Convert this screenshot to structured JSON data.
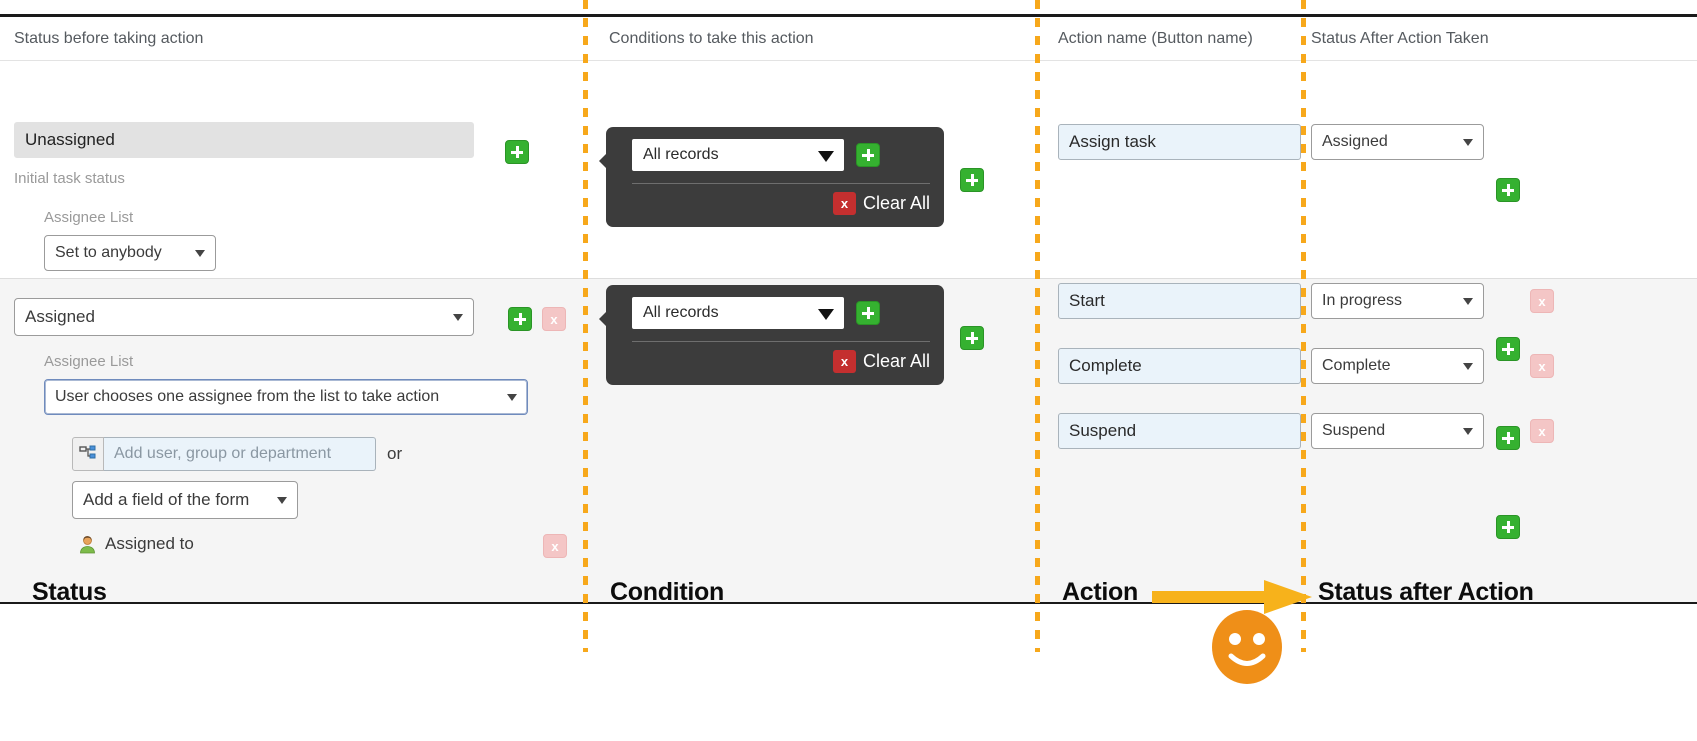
{
  "columns": [
    {
      "key": "status_before",
      "label": "Status before taking action"
    },
    {
      "key": "conditions",
      "label": "Conditions to take this action"
    },
    {
      "key": "action_name",
      "label": "Action name (Button name)"
    },
    {
      "key": "status_after",
      "label": "Status After Action Taken"
    }
  ],
  "row1": {
    "status": {
      "value": "Unassigned",
      "helper": "Initial task status",
      "assignee_list_label": "Assignee List",
      "assignee_mode": "Set to anybody",
      "add_status_button": "+"
    },
    "condition": {
      "select_value": "All records",
      "add_condition_button": "+",
      "clear_all_label": "Clear All",
      "clear_all_icon": "x",
      "add_condition_group_button": "+"
    },
    "actions": [
      {
        "action_name": "Assign task",
        "status_after": "Assigned",
        "add_button": "+",
        "delete_button": null
      }
    ]
  },
  "row2": {
    "status": {
      "value": "Assigned",
      "assignee_list_label": "Assignee List",
      "assignee_mode": "User chooses one assignee from the list to take action",
      "add_user_placeholder": "Add user, group or department",
      "or_label": "or",
      "add_field_label": "Add a field of the form",
      "assignee_chip": "Assigned to",
      "chip_delete_button": "x",
      "add_status_button": "+",
      "delete_status_button": "x"
    },
    "condition": {
      "select_value": "All records",
      "add_condition_button": "+",
      "clear_all_label": "Clear All",
      "clear_all_icon": "x",
      "add_condition_group_button": "+"
    },
    "actions": [
      {
        "action_name": "Start",
        "status_after": "In progress",
        "add_button": "+",
        "delete_button": "x"
      },
      {
        "action_name": "Complete",
        "status_after": "Complete",
        "add_button": "+",
        "delete_button": "x"
      },
      {
        "action_name": "Suspend",
        "status_after": "Suspend",
        "add_button": "+",
        "delete_button": "x"
      }
    ]
  },
  "legend": {
    "status": "Status",
    "condition": "Condition",
    "action": "Action",
    "status_after_action": "Status after Action"
  },
  "colors": {
    "accent_orange": "#f7a81b",
    "green_add": "#35b130",
    "red_clear": "#c42f2f",
    "pale_red": "#f4c6c6",
    "panel_dark": "#3c3c3c",
    "smiley": "#ef8f18"
  }
}
